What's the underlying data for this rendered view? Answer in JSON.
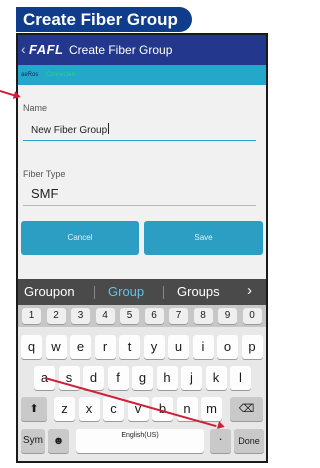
{
  "banner": {
    "title": "Create Fiber Group"
  },
  "appbar": {
    "back_glyph": "‹",
    "logo": "FAFL",
    "title": "Create Fiber Group"
  },
  "status": {
    "device": "aeRos",
    "connection": "Connected"
  },
  "form": {
    "name_label": "Name",
    "name_value": "New Fiber Group",
    "type_label": "Fiber Type",
    "type_value": "SMF",
    "cancel_label": "Cancel",
    "save_label": "Save"
  },
  "suggestions": {
    "items": [
      "Groupon",
      "Group",
      "Groups"
    ],
    "more_glyph": "›"
  },
  "keyboard": {
    "numbers": [
      "1",
      "2",
      "3",
      "4",
      "5",
      "6",
      "7",
      "8",
      "9",
      "0"
    ],
    "row1": [
      "q",
      "w",
      "e",
      "r",
      "t",
      "y",
      "u",
      "i",
      "o",
      "p"
    ],
    "row2": [
      "a",
      "s",
      "d",
      "f",
      "g",
      "h",
      "j",
      "k",
      "l"
    ],
    "row3": [
      "z",
      "x",
      "c",
      "v",
      "b",
      "n",
      "m"
    ],
    "shift_glyph": "⬆",
    "backspace_glyph": "⌫",
    "sym_label": "Sym",
    "space_label": "English(US)",
    "period_label": ".",
    "done_label": "Done"
  },
  "colors": {
    "accent": "#2c9ec4",
    "appbar": "#23378c",
    "callout": "#cf2037"
  }
}
